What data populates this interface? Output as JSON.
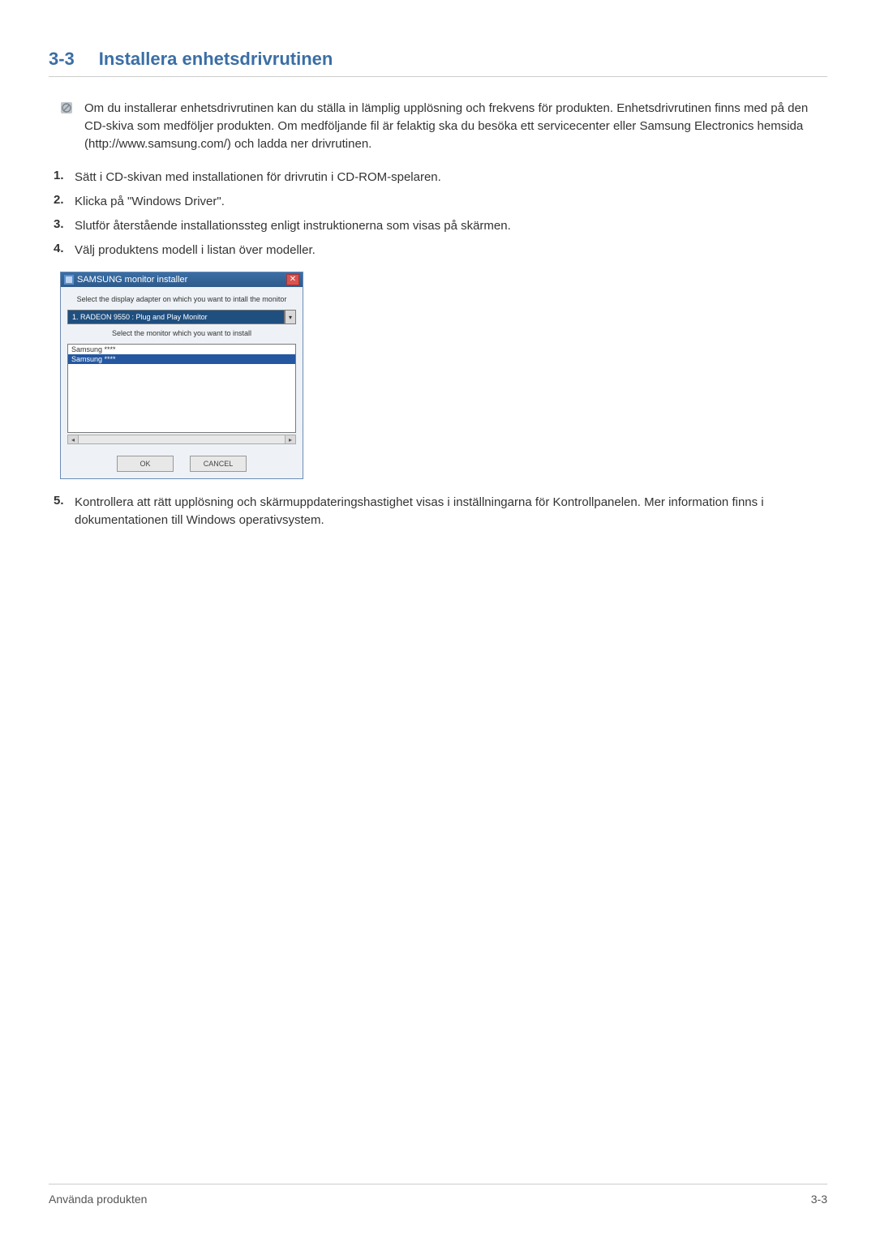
{
  "heading": {
    "number": "3-3",
    "title": "Installera enhetsdrivrutinen"
  },
  "info_text": "Om du installerar enhetsdrivrutinen kan du ställa in lämplig upplösning och frekvens för produkten. Enhetsdrivrutinen finns med på den CD-skiva som medföljer produkten. Om medföljande fil är felaktig ska du besöka ett servicecenter eller Samsung Electronics hemsida (http://www.samsung.com/) och ladda ner drivrutinen.",
  "steps": [
    "Sätt i CD-skivan med installationen för drivrutin i CD-ROM-spelaren.",
    "Klicka på \"Windows Driver\".",
    "Slutför återstående installationssteg enligt instruktionerna som visas på skärmen.",
    "Välj produktens modell i listan över modeller."
  ],
  "dialog": {
    "title": "SAMSUNG monitor installer",
    "caption1": "Select the display adapter on which you want to intall the monitor",
    "dropdown_value": "1. RADEON 9550 : Plug and Play Monitor",
    "caption2": "Select the monitor which you want to install",
    "list_items": [
      "Samsung ****",
      "Samsung ****"
    ],
    "ok_label": "OK",
    "cancel_label": "CANCEL"
  },
  "step5": "Kontrollera att rätt upplösning och skärmuppdateringshastighet visas i inställningarna för Kontrollpanelen. Mer information finns i dokumentationen till Windows operativsystem.",
  "footer": {
    "left": "Använda produkten",
    "right": "3-3"
  }
}
